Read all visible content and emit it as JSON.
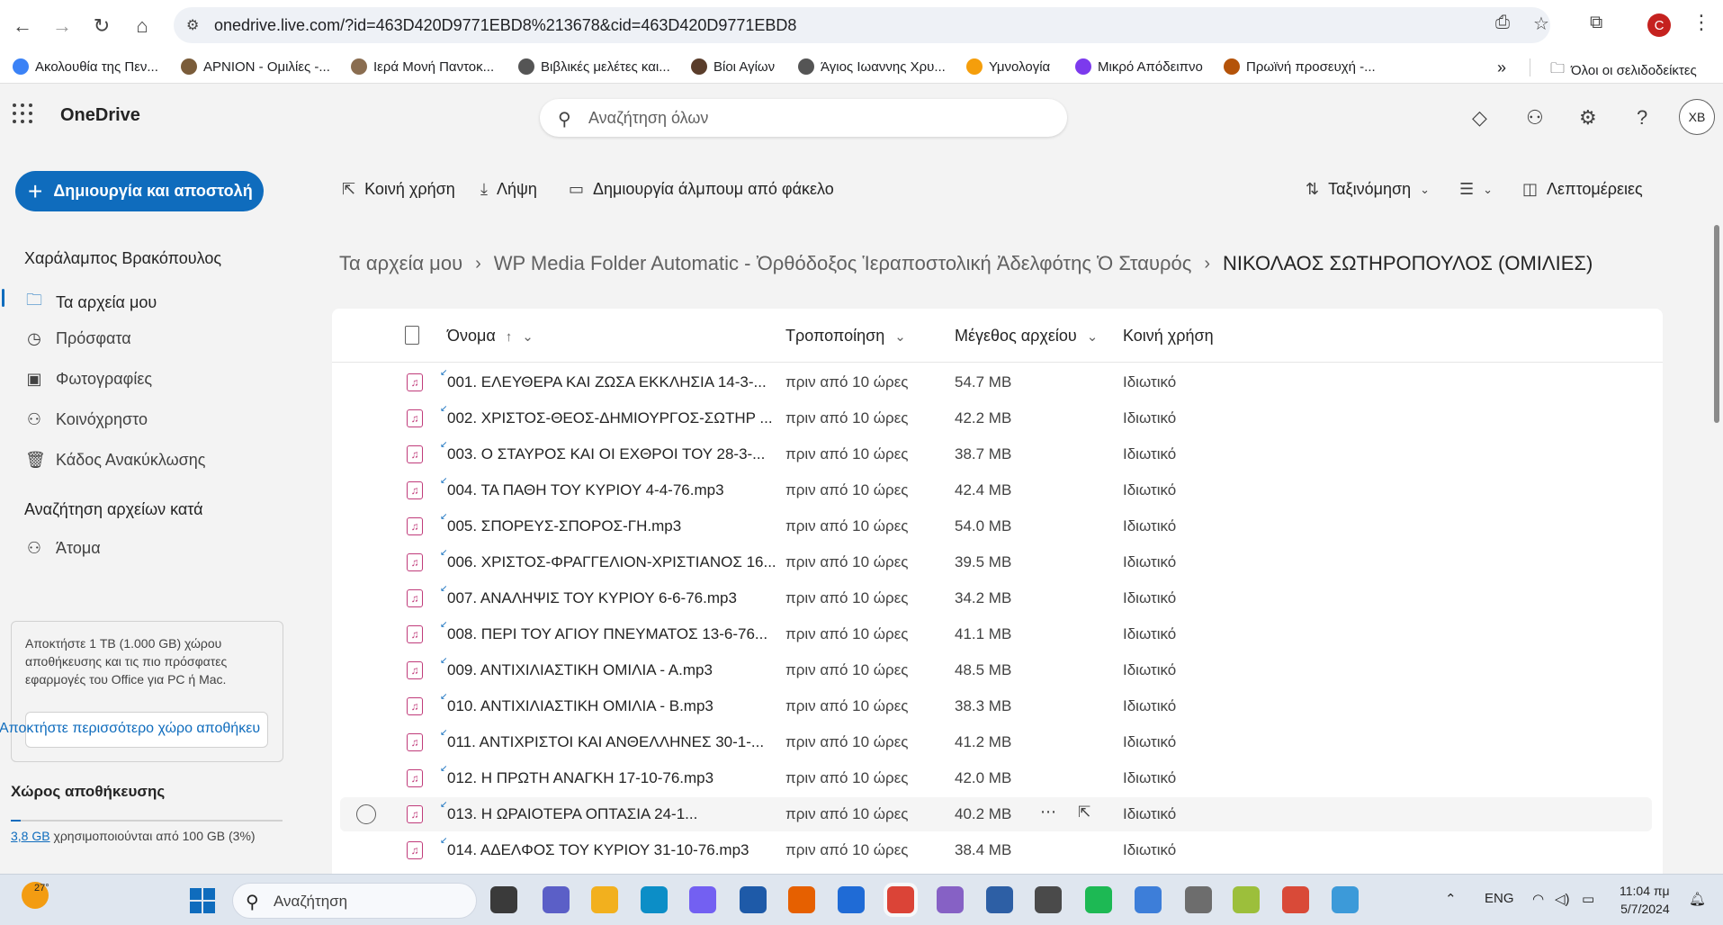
{
  "browser": {
    "url": "onedrive.live.com/?id=463D420D9771EBD8%213678&cid=463D420D9771EBD8",
    "profile_initial": "C",
    "bookmarks": [
      {
        "label": "Ακολουθία της Πεν...",
        "color": "#3b82f6"
      },
      {
        "label": "ΑΡΝΙΟΝ - Ομιλίες -...",
        "color": "#7a5c3a"
      },
      {
        "label": "Ιερά Μονή Παντοκ...",
        "color": "#8a6d50"
      },
      {
        "label": "Βιβλικές μελέτες και...",
        "color": "#555555"
      },
      {
        "label": "Βίοι Αγίων",
        "color": "#5a3d2b"
      },
      {
        "label": "Άγιος Ιωαννης Χρυ...",
        "color": "#555555"
      },
      {
        "label": "Υμνολογία",
        "color": "#f59e0b"
      },
      {
        "label": "Μικρό Απόδειπνο",
        "color": "#7c3aed"
      },
      {
        "label": "Πρωϊνή προσευχή -...",
        "color": "#b45309"
      }
    ],
    "more_bookmarks": "»",
    "all_bookmarks_label": "Όλοι οι σελιδοδείκτες"
  },
  "header": {
    "brand": "OneDrive",
    "search_placeholder": "Αναζήτηση όλων",
    "avatar_initials": "ΧΒ"
  },
  "sidebar": {
    "create_label": "Δημιουργία και αποστολή",
    "user_name": "Χαράλαμπος Βρακόπουλος",
    "items": [
      {
        "label": "Τα αρχεία μου",
        "icon": "folder-icon"
      },
      {
        "label": "Πρόσφατα",
        "icon": "clock-icon"
      },
      {
        "label": "Φωτογραφίες",
        "icon": "image-icon"
      },
      {
        "label": "Κοινόχρηστο",
        "icon": "people-icon"
      },
      {
        "label": "Κάδος Ανακύκλωσης",
        "icon": "recycle-bin-icon"
      }
    ],
    "search_by_heading": "Αναζήτηση αρχείων κατά",
    "people_label": "Άτομα",
    "promo_text": "Αποκτήστε 1 TB (1.000 GB) χώρου αποθήκευσης και τις πιο πρόσφατες εφαρμογές του Office για PC ή Mac.",
    "promo_button": "Αποκτήστε περισσότερο χώρο αποθήκευ",
    "storage_title": "Χώρος αποθήκευσης",
    "storage_used": "3,8 GB",
    "storage_rest": " χρησιμοποιούνται από 100 GB (3%)",
    "storage_fraction": 0.038
  },
  "commands": {
    "share": "Κοινή χρήση",
    "download": "Λήψη",
    "create_album": "Δημιουργία άλμπουμ από φάκελο",
    "sort": "Ταξινόμηση",
    "details": "Λεπτομέρειες"
  },
  "breadcrumb": {
    "root": "Τα αρχεία μου",
    "middle": "WP Media Folder Automatic - Ὀρθόδοξος Ἱεραποστολική Ἀδελφότης Ὁ Σταυρός",
    "current": "ΝΙΚΟΛΑΟΣ ΣΩΤΗΡΟΠΟΥΛΟΣ (ΟΜΙΛΙΕΣ)"
  },
  "columns": {
    "name": "Όνομα",
    "modified": "Τροποποίηση",
    "size": "Μέγεθος αρχείου",
    "sharing": "Κοινή χρήση"
  },
  "files": [
    {
      "name": "001. ΕΛΕΥΘΕΡΑ ΚΑΙ ΖΩΣΑ ΕΚΚΛΗΣΙΑ  14-3-...",
      "modified": "πριν από 10 ώρες",
      "size": "54.7 MB",
      "sharing": "Ιδιωτικό"
    },
    {
      "name": "002. ΧΡΙΣΤΟΣ-ΘΕΟΣ-ΔΗΜΙΟΥΡΓΟΣ-ΣΩΤΗΡ ...",
      "modified": "πριν από 10 ώρες",
      "size": "42.2 MB",
      "sharing": "Ιδιωτικό"
    },
    {
      "name": "003. Ο ΣΤΑΥΡΟΣ ΚΑΙ ΟΙ ΕΧΘΡΟΙ ΤΟΥ 28-3-...",
      "modified": "πριν από 10 ώρες",
      "size": "38.7 MB",
      "sharing": "Ιδιωτικό"
    },
    {
      "name": "004. ΤΑ ΠΑΘΗ ΤΟΥ ΚΥΡΙΟΥ 4-4-76.mp3",
      "modified": "πριν από 10 ώρες",
      "size": "42.4 MB",
      "sharing": "Ιδιωτικό"
    },
    {
      "name": "005. ΣΠΟΡΕΥΣ-ΣΠΟΡΟΣ-ΓΗ.mp3",
      "modified": "πριν από 10 ώρες",
      "size": "54.0 MB",
      "sharing": "Ιδιωτικό"
    },
    {
      "name": "006. ΧΡΙΣΤΟΣ-ΦΡΑΓΓΕΛΙΟΝ-ΧΡΙΣΤΙΑΝΟΣ 16...",
      "modified": "πριν από 10 ώρες",
      "size": "39.5 MB",
      "sharing": "Ιδιωτικό"
    },
    {
      "name": "007. ΑΝΑΛΗΨΙΣ ΤΟΥ ΚΥΡΙΟΥ 6-6-76.mp3",
      "modified": "πριν από 10 ώρες",
      "size": "34.2 MB",
      "sharing": "Ιδιωτικό"
    },
    {
      "name": "008. ΠΕΡΙ ΤΟΥ ΑΓΙΟΥ ΠΝΕΥΜΑΤΟΣ 13-6-76...",
      "modified": "πριν από 10 ώρες",
      "size": "41.1 MB",
      "sharing": "Ιδιωτικό"
    },
    {
      "name": "009. ΑΝΤΙΧΙΛΙΑΣΤΙΚΗ ΟΜΙΛΙΑ - Α.mp3",
      "modified": "πριν από 10 ώρες",
      "size": "48.5 MB",
      "sharing": "Ιδιωτικό"
    },
    {
      "name": "010. ΑΝΤΙΧΙΛΙΑΣΤΙΚΗ ΟΜΙΛΙΑ - Β.mp3",
      "modified": "πριν από 10 ώρες",
      "size": "38.3 MB",
      "sharing": "Ιδιωτικό"
    },
    {
      "name": "011. ΑΝΤΙΧΡΙΣΤΟΙ ΚΑΙ ΑΝΘΕΛΛΗΝΕΣ 30-1-...",
      "modified": "πριν από 10 ώρες",
      "size": "41.2 MB",
      "sharing": "Ιδιωτικό"
    },
    {
      "name": "012. Η ΠΡΩΤΗ ΑΝΑΓΚΗ 17-10-76.mp3",
      "modified": "πριν από 10 ώρες",
      "size": "42.0 MB",
      "sharing": "Ιδιωτικό"
    },
    {
      "name": "013. Η ΩΡΑΙΟΤΕΡΑ ΟΠΤΑΣΙΑ 24-1...",
      "modified": "πριν από 10 ώρες",
      "size": "40.2 MB",
      "sharing": "Ιδιωτικό"
    },
    {
      "name": "014. ΑΔΕΛΦΟΣ ΤΟΥ ΚΥΡΙΟΥ 31-10-76.mp3",
      "modified": "πριν από 10 ώρες",
      "size": "38.4 MB",
      "sharing": "Ιδιωτικό"
    }
  ],
  "taskbar": {
    "temperature": "27°",
    "search_label": "Αναζήτηση",
    "language": "ENG",
    "time": "11:04 πμ",
    "date": "5/7/2024",
    "apps": [
      {
        "name": "task-view",
        "color": "#3a3a3a"
      },
      {
        "name": "teams",
        "color": "#5b5fc7"
      },
      {
        "name": "file-explorer",
        "color": "#f2b01e"
      },
      {
        "name": "edge",
        "color": "#0c8ec7"
      },
      {
        "name": "viber",
        "color": "#7360f2"
      },
      {
        "name": "store",
        "color": "#1e5aa8"
      },
      {
        "name": "firefox",
        "color": "#e66000"
      },
      {
        "name": "thunderbird",
        "color": "#1f6bd6"
      },
      {
        "name": "chrome",
        "color": "#db4437"
      },
      {
        "name": "visual-studio",
        "color": "#8661c5"
      },
      {
        "name": "fluent-app",
        "color": "#2d5fa5"
      },
      {
        "name": "calculator",
        "color": "#4a4a4a"
      },
      {
        "name": "spotify",
        "color": "#1db954"
      },
      {
        "name": "notepad",
        "color": "#3d7ed9"
      },
      {
        "name": "text-app",
        "color": "#6d6d6d"
      },
      {
        "name": "paint-app",
        "color": "#9cbf3b"
      },
      {
        "name": "tool-app",
        "color": "#d94a38"
      },
      {
        "name": "snip-app",
        "color": "#3c9ad9"
      }
    ]
  }
}
